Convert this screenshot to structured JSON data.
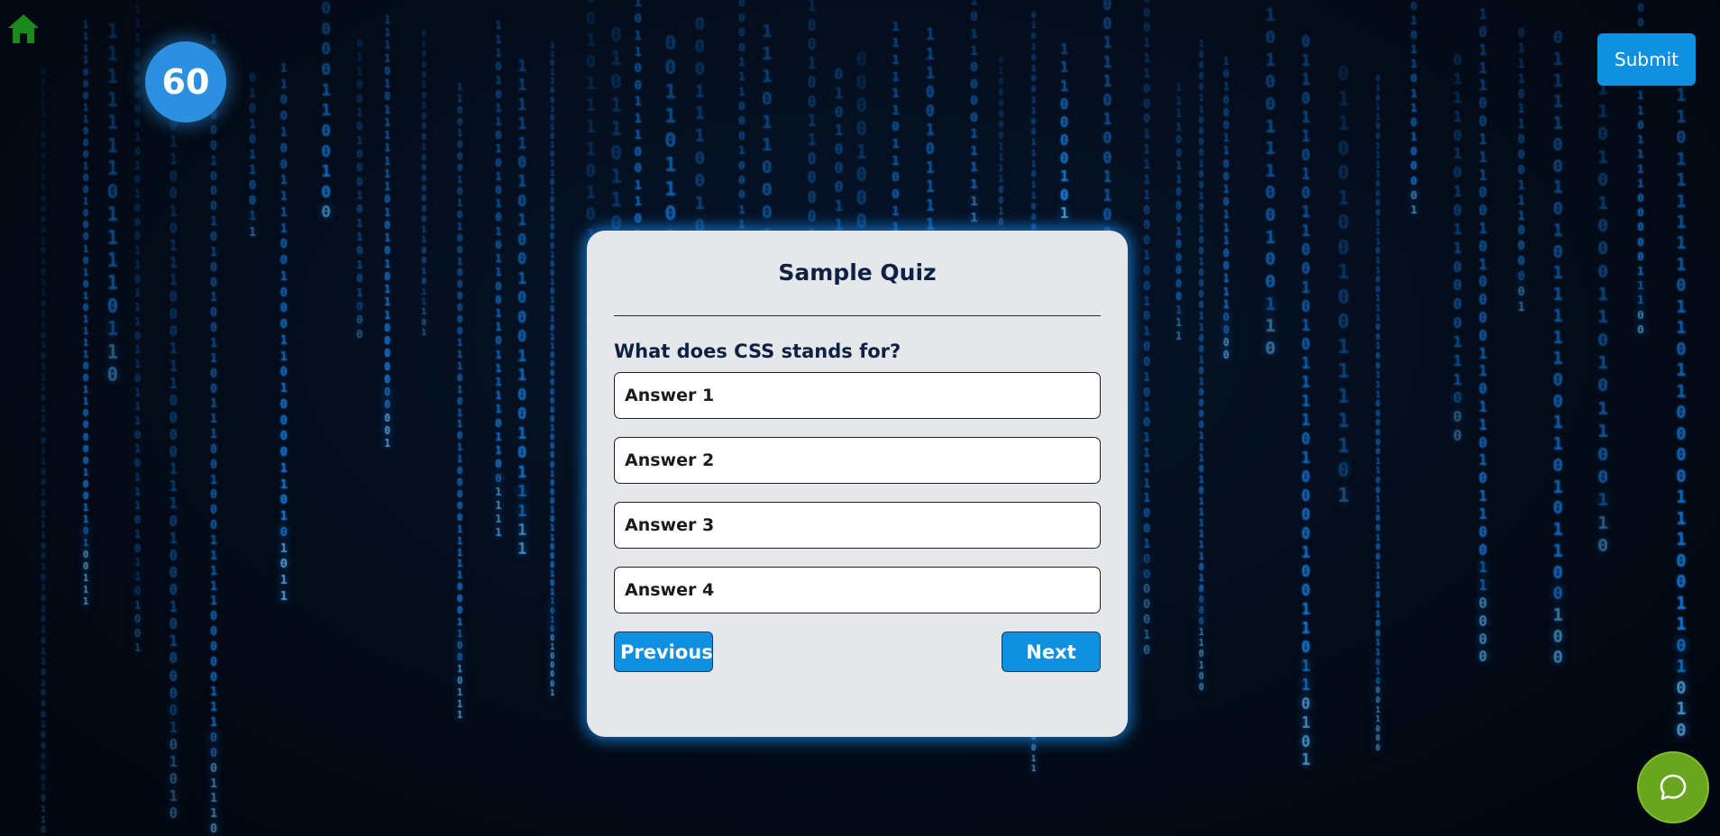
{
  "icons": {
    "home": "home-icon",
    "chat": "chat-bubble-icon"
  },
  "colors": {
    "accent": "#1090e0",
    "timer": "#2d8fe0",
    "home": "#1a8a1a",
    "chat": "#6aa51f",
    "card": "#e6e7eb",
    "title_text": "#0d2243",
    "matrix_glyph": "#1e90ff"
  },
  "timer": {
    "value": "60"
  },
  "header": {
    "submit_label": "Submit"
  },
  "quiz": {
    "title": "Sample Quiz",
    "question": "What does CSS stands for?",
    "answers": [
      "Answer 1",
      "Answer 2",
      "Answer 3",
      "Answer 4"
    ],
    "previous_label": "Previous",
    "next_label": "Next"
  }
}
